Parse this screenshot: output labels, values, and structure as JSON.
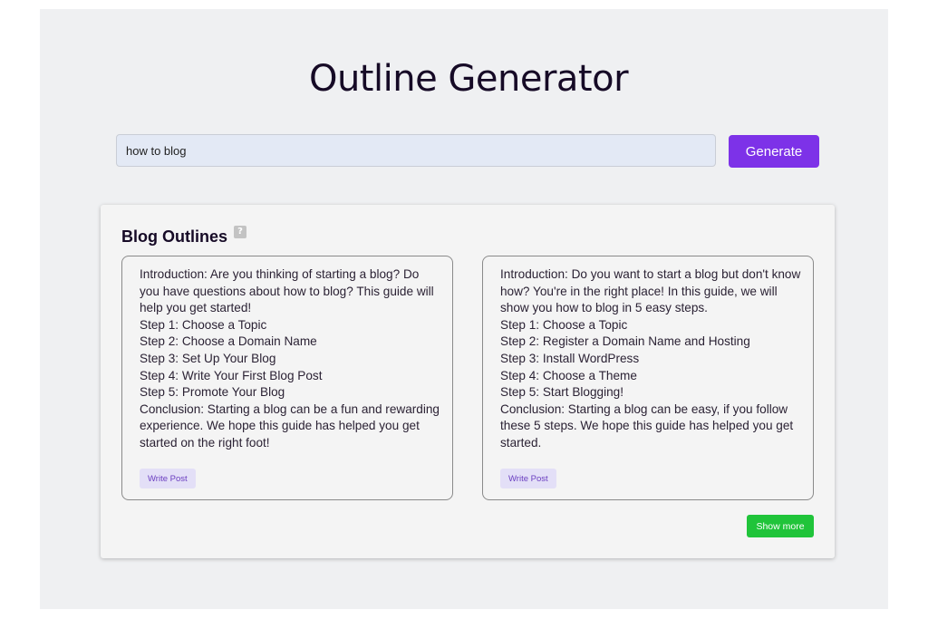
{
  "header": {
    "title": "Outline Generator"
  },
  "search": {
    "value": "how to blog",
    "button_label": "Generate"
  },
  "results": {
    "title": "Blog Outlines",
    "help_icon_glyph": "?",
    "outlines": [
      {
        "text": "Introduction: Are you thinking of starting a blog? Do you have questions about how to blog? This guide will help you get started!\nStep 1: Choose a Topic\nStep 2: Choose a Domain Name\nStep 3: Set Up Your Blog\nStep 4: Write Your First Blog Post\nStep 5: Promote Your Blog\nConclusion: Starting a blog can be a fun and rewarding experience. We hope this guide has helped you get started on the right foot!",
        "button_label": "Write Post"
      },
      {
        "text": "Introduction: Do you want to start a blog but don't know how? You're in the right place! In this guide, we will show you how to blog in 5 easy steps.\nStep 1: Choose a Topic\nStep 2: Register a Domain Name and Hosting\nStep 3: Install WordPress\nStep 4: Choose a Theme\nStep 5: Start Blogging!\nConclusion: Starting a blog can be easy, if you follow these 5 steps. We hope this guide has helped you get started.",
        "button_label": "Write Post"
      }
    ],
    "show_more_label": "Show more"
  },
  "colors": {
    "accent": "#7d32e8",
    "success": "#20c43a",
    "page_background": "#eff0f2",
    "input_background": "#e3e9f5"
  },
  "icons": {
    "help": "help-icon"
  }
}
